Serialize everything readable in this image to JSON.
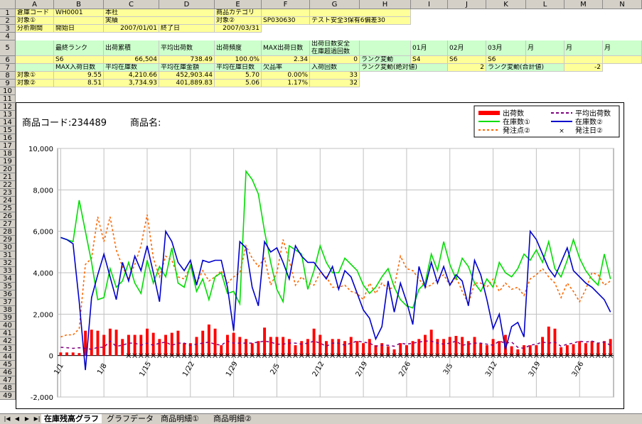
{
  "columns": [
    "A",
    "B",
    "C",
    "D",
    "E",
    "F",
    "G",
    "H",
    "I",
    "J",
    "K",
    "L",
    "M",
    "N"
  ],
  "rows": [
    "1",
    "2",
    "3",
    "4",
    "5",
    "6",
    "7",
    "8",
    "9",
    "10",
    "11",
    "12",
    "13",
    "14",
    "15",
    "16",
    "17",
    "18",
    "19",
    "20",
    "21",
    "22",
    "23",
    "24",
    "25",
    "26",
    "27",
    "28",
    "29",
    "30",
    "31",
    "32",
    "33",
    "34",
    "35",
    "36",
    "37",
    "38",
    "39",
    "40",
    "41",
    "42",
    "43",
    "44",
    "45",
    "46",
    "47",
    "48",
    "49"
  ],
  "cells": {
    "r1": {
      "a": "倉庫コード",
      "b": "WH0001",
      "c": "本社",
      "e": "商品カテゴリ"
    },
    "r2": {
      "a": "対象①",
      "c": "実績",
      "e": "対象②",
      "f": "SP030630",
      "g": "テスト安全3保有6偏差30"
    },
    "r3": {
      "a": "分析期間",
      "b": "開始日",
      "c": "2007/01/01",
      "d": "終了日",
      "e": "2007/03/31"
    },
    "r5": {
      "b": "最終ランク",
      "c": "出荷累積",
      "d": "平均出荷数",
      "e": "出荷頻度",
      "f": "MAX出荷日数",
      "g1": "出荷日数安全",
      "g2": "在庫超過回数",
      "i": "01月",
      "j": "02月",
      "k": "03月",
      "l": "月",
      "m": "月",
      "n": "月"
    },
    "r6": {
      "b": "S6",
      "c": "66,504",
      "d": "738.49",
      "e": "100.0%",
      "f": "2.34",
      "g": "0",
      "h": "ランク変動",
      "i": "S4",
      "j": "S6",
      "k": "S6"
    },
    "r7": {
      "b": "MAX入荷日数",
      "c": "平均在庫数",
      "d": "平均在庫金額",
      "e": "平均在庫日数",
      "f": "欠品率",
      "g": "入荷回数",
      "h": "ランク変動(絶対値)",
      "j": "2",
      "k": "ランク変動(合計値)",
      "m": "-2"
    },
    "r8": {
      "a": "対象①",
      "b": "9.55",
      "c": "4,210.66",
      "d": "452,903.44",
      "e": "5.70",
      "f": "0.00%",
      "g": "33"
    },
    "r9": {
      "a": "対象②",
      "b": "8.51",
      "c": "3,734.93",
      "d": "401,889.83",
      "e": "5.06",
      "f": "1.17%",
      "g": "32"
    }
  },
  "chart": {
    "product_code_label": "商品コード:234489",
    "product_name_label": "商品名:",
    "legend": {
      "shipments": "出荷数",
      "avg_shipments": "平均出荷数",
      "stock1": "在庫数①",
      "stock2": "在庫数②",
      "reorder2": "発注点②",
      "orderday2": "発注日②"
    },
    "colors": {
      "shipments": "#ff0000",
      "avg": "#800080",
      "stock1": "#00dd00",
      "stock2": "#0000cc",
      "reorder": "#ff6600",
      "grid": "#c0c0c0"
    }
  },
  "chart_data": {
    "type": "line",
    "ylim": [
      -2000,
      10000
    ],
    "yticks": [
      -2000,
      0,
      2000,
      4000,
      6000,
      8000,
      10000
    ],
    "ytick_labels": [
      "-2,000",
      "0",
      "2,000",
      "4,000",
      "6,000",
      "8,000",
      "10,000"
    ],
    "xtick_labels": [
      "1/1",
      "1/8",
      "1/15",
      "1/22",
      "1/29",
      "2/5",
      "2/12",
      "2/19",
      "2/26",
      "3/5",
      "3/12",
      "3/19",
      "3/26"
    ],
    "days": 90,
    "series": [
      {
        "name": "出荷数",
        "kind": "bar",
        "values": [
          150,
          150,
          150,
          120,
          1200,
          1250,
          1200,
          1000,
          1300,
          1250,
          800,
          1000,
          1000,
          1000,
          1300,
          1100,
          800,
          1000,
          1100,
          1200,
          600,
          600,
          900,
          1200,
          1500,
          1300,
          500,
          1000,
          1100,
          900,
          800,
          600,
          700,
          1350,
          900,
          900,
          900,
          800,
          500,
          700,
          800,
          1300,
          1000,
          700,
          800,
          800,
          700,
          900,
          700,
          600,
          800,
          500,
          600,
          450,
          300,
          600,
          500,
          700,
          800,
          1000,
          1250,
          800,
          800,
          900,
          950,
          900,
          700,
          900,
          600,
          500,
          800,
          700,
          1000,
          450,
          300,
          500,
          500,
          500,
          900,
          1400,
          1300,
          400,
          500,
          550,
          700,
          600,
          700,
          600,
          700,
          800
        ]
      },
      {
        "name": "平均出荷数",
        "kind": "line",
        "values": [
          400,
          380,
          350,
          380,
          350,
          300,
          400,
          400,
          700,
          450,
          500,
          600,
          600,
          500,
          600,
          500,
          600,
          650,
          500,
          600,
          600,
          500,
          550,
          600,
          650,
          550,
          500,
          700,
          600,
          600,
          600,
          600,
          650,
          700,
          650,
          550,
          550,
          600,
          600,
          550,
          600,
          700,
          600,
          450,
          600,
          600,
          500,
          600,
          700,
          650,
          600,
          450,
          500,
          500,
          450,
          600,
          550,
          600,
          650,
          700,
          700,
          600,
          550,
          600,
          700,
          500,
          550,
          600,
          600,
          550,
          500,
          700,
          600,
          650,
          400,
          350,
          500,
          550,
          650,
          600,
          650,
          450,
          550,
          600,
          700,
          650,
          700,
          600,
          650,
          500
        ]
      },
      {
        "name": "在庫数①",
        "kind": "line",
        "values": [
          5700,
          5600,
          5500,
          7500,
          6000,
          4500,
          2700,
          2800,
          4200,
          3300,
          3600,
          4500,
          3500,
          3000,
          4600,
          3500,
          4300,
          3800,
          5200,
          3500,
          3300,
          4400,
          3100,
          3700,
          2700,
          3800,
          4000,
          3000,
          3100,
          2500,
          8900,
          8500,
          7800,
          6000,
          4500,
          3200,
          2600,
          5300,
          5100,
          4900,
          3200,
          4100,
          5300,
          4500,
          4000,
          4000,
          4700,
          4400,
          4100,
          3400,
          3000,
          3300,
          3800,
          4200,
          3300,
          2700,
          2400,
          2300,
          3200,
          3500,
          4900,
          4100,
          5500,
          4400,
          3700,
          4700,
          4300,
          3500,
          3100,
          3700,
          3300,
          4500,
          4000,
          3800,
          4200,
          4900,
          4600,
          5100,
          4500,
          5500,
          4200,
          3800,
          4600,
          5600,
          4700,
          4100,
          3700,
          3400,
          4900,
          3700
        ]
      },
      {
        "name": "在庫数②",
        "kind": "line",
        "values": [
          5700,
          5600,
          5400,
          2600,
          -700,
          2800,
          3900,
          4900,
          3800,
          2700,
          4500,
          3600,
          4800,
          4100,
          5300,
          4000,
          2600,
          6000,
          5500,
          4500,
          4100,
          4600,
          3400,
          4600,
          4500,
          4600,
          4600,
          3300,
          1200,
          5500,
          5200,
          3300,
          2400,
          5500,
          5000,
          5200,
          4500,
          3700,
          5300,
          4800,
          4500,
          4500,
          4100,
          3700,
          4300,
          3200,
          4100,
          3800,
          3000,
          2200,
          1800,
          800,
          1400,
          3600,
          2100,
          3500,
          2600,
          1500,
          4300,
          3300,
          4500,
          3500,
          4300,
          3400,
          3900,
          3600,
          2400,
          4600,
          3900,
          2700,
          1300,
          2000,
          300,
          1400,
          1600,
          900,
          6000,
          5600,
          4900,
          4200,
          3800,
          4500,
          5200,
          4100,
          3800,
          3500,
          3300,
          3000,
          2700,
          2100
        ]
      },
      {
        "name": "発注点②",
        "kind": "line",
        "values": [
          900,
          1000,
          1000,
          1300,
          4400,
          4700,
          6700,
          5500,
          6700,
          5100,
          4300,
          3700,
          4400,
          5300,
          6800,
          4700,
          3800,
          4800,
          4600,
          3800,
          3700,
          4300,
          3500,
          4100,
          3600,
          3800,
          4100,
          3500,
          3800,
          4000,
          5300,
          4700,
          4300,
          4700,
          3400,
          4000,
          5600,
          4600,
          3400,
          3800,
          3500,
          3400,
          4000,
          3800,
          3300,
          3300,
          3400,
          3100,
          3000,
          2700,
          3500,
          3000,
          3500,
          3200,
          3300,
          4800,
          4200,
          4100,
          3700,
          3300,
          3400,
          3700,
          3900,
          3400,
          3800,
          3100,
          2500,
          3500,
          3500,
          3300,
          3700,
          3100,
          3500,
          3200,
          3300,
          2900,
          3700,
          3900,
          4200,
          3800,
          3500,
          2800,
          3500,
          3100,
          2600,
          3200,
          4000,
          3900,
          3400,
          3600
        ]
      },
      {
        "name": "発注日②",
        "kind": "marker",
        "values": [
          0,
          0,
          0,
          0,
          0,
          0,
          0,
          0,
          0,
          0,
          0,
          0,
          0,
          0,
          0,
          0,
          0,
          0,
          0,
          0,
          0,
          0,
          0,
          0,
          0,
          0,
          0,
          0,
          0,
          0,
          0,
          0,
          0,
          0,
          0,
          0,
          0,
          0,
          0,
          0,
          0,
          0,
          0,
          0,
          0,
          0,
          0,
          0,
          0,
          0,
          0,
          0,
          0,
          0,
          0,
          0,
          0,
          0,
          0,
          0,
          0,
          0,
          0,
          0,
          0,
          0,
          0,
          0,
          0,
          0,
          0,
          0,
          0,
          0,
          0,
          0,
          0,
          0,
          0,
          0,
          0,
          0,
          0,
          0,
          0,
          0,
          0,
          0,
          0,
          0
        ]
      }
    ]
  },
  "tabs": [
    "在庫残高グラフ",
    "グラフデータ",
    "商品明細①",
    "商品明細②"
  ]
}
